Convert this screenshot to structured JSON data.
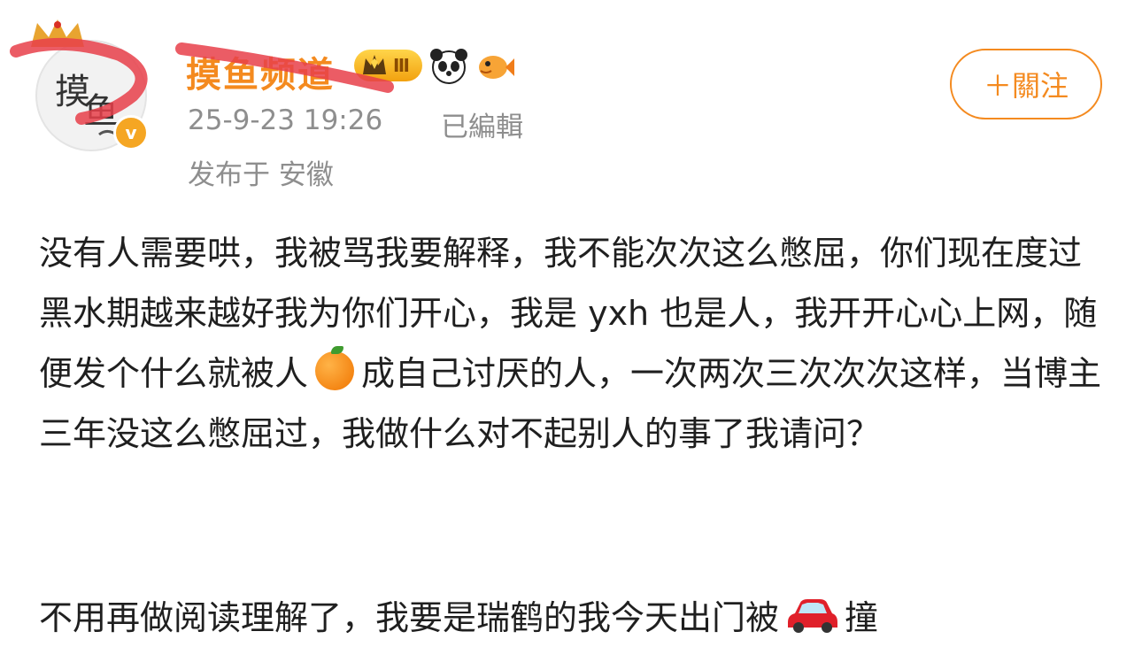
{
  "user": {
    "name": "摸鱼频道",
    "level": "Ⅲ",
    "verified_mark": "v"
  },
  "post": {
    "timestamp": "25-9-23 19:26",
    "edited_label": "已編輯",
    "location": "发布于 安徽",
    "paragraph1_a": "没有人需要哄，我被骂我要解释，我不能次次这么憋屈，你们现在度过黑水期越来越好我为你们开心，我是 yxh 也是人，我开开心心上网，随便发个什么就被人",
    "paragraph1_b": "成自己讨厌的人，一次两次三次次次这样，当博主三年没这么憋屈过，我做什么对不起别人的事了我请问？",
    "paragraph2_a": "不用再做阅读理解了，我要是瑞鹤的我今天出门被",
    "paragraph2_b": "撞"
  },
  "actions": {
    "follow_label": "＋關注"
  },
  "icons": [
    "avatar",
    "crown-icon",
    "level-badge",
    "panda-icon",
    "fish-icon",
    "orange-emoji",
    "car-emoji",
    "verified-icon"
  ],
  "colors": {
    "accent": "#f48a1f",
    "meta": "#8e8e8e",
    "text": "#1f1f1f",
    "redmark": "#e8404a"
  }
}
